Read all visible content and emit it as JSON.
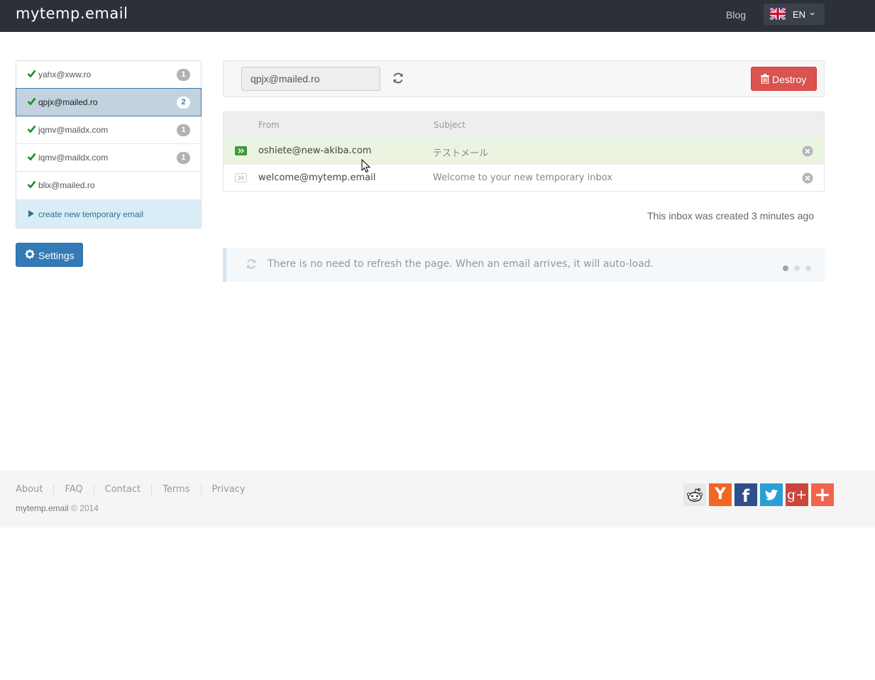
{
  "header": {
    "logo": "mytemp.email",
    "blog_label": "Blog",
    "language": "EN"
  },
  "sidebar": {
    "items": [
      {
        "address": "yahx@xww.ro",
        "count": "1",
        "active": false
      },
      {
        "address": "qpjx@mailed.ro",
        "count": "2",
        "active": true
      },
      {
        "address": "jqmv@maildx.com",
        "count": "1",
        "active": false
      },
      {
        "address": "iqmv@maildx.com",
        "count": "1",
        "active": false
      },
      {
        "address": "blix@mailed.ro",
        "count": "",
        "active": false
      }
    ],
    "create_label": "create new temporary email",
    "settings_label": "Settings"
  },
  "toolbar": {
    "address_value": "qpjx@mailed.ro",
    "destroy_label": "Destroy"
  },
  "inbox": {
    "columns": {
      "from": "From",
      "subject": "Subject"
    },
    "messages": [
      {
        "from": "oshiete@new-akiba.com",
        "subject": "テストメール",
        "unread": true
      },
      {
        "from": "welcome@mytemp.email",
        "subject": "Welcome to your new temporary inbox",
        "unread": false
      }
    ],
    "created_text": "This inbox was created 3 minutes ago",
    "notice_text": "There is no need to refresh the page. When an email arrives, it will auto-load."
  },
  "footer": {
    "links": [
      "About",
      "FAQ",
      "Contact",
      "Terms",
      "Privacy"
    ],
    "brand": "mytemp.email",
    "copyright": "© 2014",
    "social_icons": [
      "reddit-icon",
      "hacker-news-icon",
      "facebook-icon",
      "twitter-icon",
      "google-plus-icon",
      "share-icon"
    ]
  },
  "colors": {
    "topbar": "#2c3138",
    "primary": "#337ab7",
    "danger": "#d9534f",
    "check": "#1f8a2b",
    "unread_row": "#eaf4e1"
  }
}
